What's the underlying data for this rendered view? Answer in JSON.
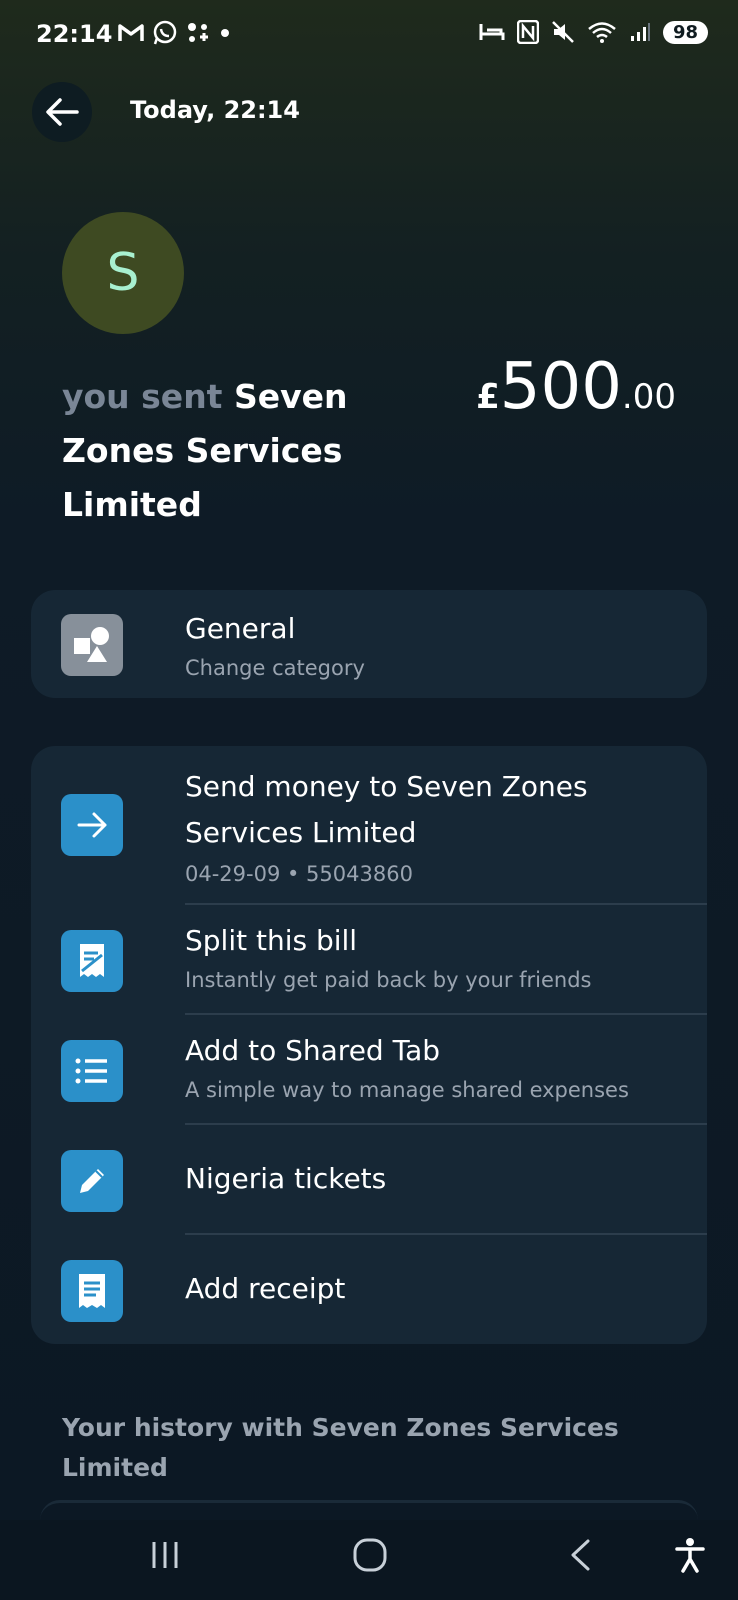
{
  "status_bar": {
    "time": "22:14",
    "left_icons": [
      "gmail-icon",
      "whatsapp-icon",
      "app-grid-icon",
      "dot-icon"
    ],
    "right_icons": [
      "bed-icon",
      "nfc-icon",
      "mute-icon",
      "wifi-icon",
      "signal-icon"
    ],
    "battery": "98"
  },
  "header": {
    "back_icon": "arrow-left-icon",
    "title": "Today, 22:14"
  },
  "avatar": {
    "letter": "S"
  },
  "transaction": {
    "prefix": "you sent",
    "recipient": "Seven Zones Services Limited",
    "currency": "£",
    "amount_main": "500",
    "amount_decimal": ".00"
  },
  "category": {
    "icon": "shapes-icon",
    "title": "General",
    "subtitle": "Change category"
  },
  "actions": [
    {
      "icon": "arrow-right-icon",
      "title_line1": "Send money to Seven Zones",
      "title_line2": "Services Limited",
      "subtitle": "04-29-09 • 55043860"
    },
    {
      "icon": "split-bill-icon",
      "title": "Split this bill",
      "subtitle": "Instantly get paid back by your friends"
    },
    {
      "icon": "list-icon",
      "title": "Add to Shared Tab",
      "subtitle": "A simple way to manage shared expenses"
    },
    {
      "icon": "pencil-icon",
      "title": "Nigeria tickets"
    },
    {
      "icon": "receipt-icon",
      "title": "Add receipt"
    }
  ],
  "history": {
    "heading": "Your history with Seven Zones Services Limited"
  },
  "nav": [
    "recent-apps-icon",
    "home-icon",
    "back-icon",
    "accessibility-icon"
  ],
  "colors": {
    "accent_blue": "#2b90c9",
    "card_bg": "#162735",
    "avatar_bg": "#3e4a22",
    "avatar_letter": "#a8f0d0"
  }
}
